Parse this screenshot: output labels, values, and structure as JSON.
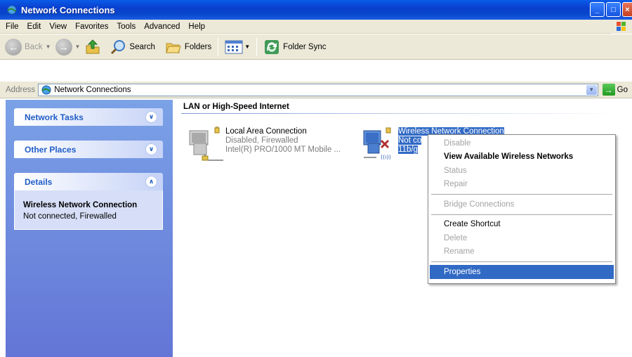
{
  "window": {
    "title": "Network Connections"
  },
  "menubar": {
    "items": [
      "File",
      "Edit",
      "View",
      "Favorites",
      "Tools",
      "Advanced",
      "Help"
    ]
  },
  "toolbar": {
    "back_label": "Back",
    "search_label": "Search",
    "folders_label": "Folders",
    "folder_sync_label": "Folder Sync"
  },
  "address": {
    "label": "Address",
    "value": "Network Connections",
    "go_label": "Go"
  },
  "sidebar": {
    "network_tasks": "Network Tasks",
    "other_places": "Other Places",
    "details": {
      "title": "Details",
      "name": "Wireless Network Connection",
      "status": "Not connected, Firewalled"
    }
  },
  "main": {
    "section_title": "LAN or High-Speed Internet",
    "connections": [
      {
        "name": "Local Area Connection",
        "status": "Disabled, Firewalled",
        "device": "Intel(R) PRO/1000 MT Mobile ..."
      },
      {
        "name": "Wireless Network Connection",
        "status": "Not co",
        "device": "11b/g"
      }
    ]
  },
  "context_menu": {
    "items": [
      {
        "label": "Disable",
        "state": "disabled"
      },
      {
        "label": "View Available Wireless Networks",
        "state": "default"
      },
      {
        "label": "Status",
        "state": "disabled"
      },
      {
        "label": "Repair",
        "state": "disabled"
      },
      {
        "label": "Bridge Connections",
        "state": "disabled"
      },
      {
        "label": "Create Shortcut",
        "state": "enabled"
      },
      {
        "label": "Delete",
        "state": "disabled"
      },
      {
        "label": "Rename",
        "state": "disabled"
      },
      {
        "label": "Properties",
        "state": "highlighted"
      }
    ]
  },
  "colors": {
    "titlebar": "#0a3fcf",
    "highlight": "#316ac5",
    "sidebar_top": "#7ba2e7",
    "sidebar_bottom": "#6375d6",
    "group_title": "#215dc6"
  },
  "icons": {
    "window": "network-connections-icon",
    "back": "back-arrow-icon",
    "forward": "forward-arrow-icon",
    "up": "up-folder-icon",
    "search": "search-icon",
    "folders": "folders-icon",
    "views": "views-icon",
    "folder_sync": "folder-sync-icon",
    "go": "go-arrow-icon"
  }
}
